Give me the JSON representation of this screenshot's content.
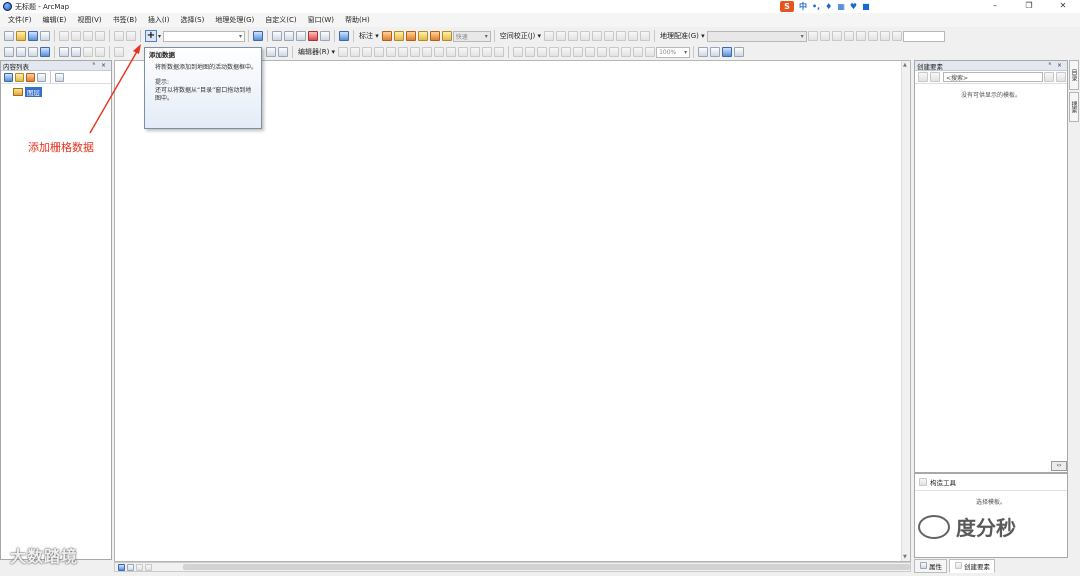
{
  "window": {
    "title": "无标题 - ArcMap",
    "minimize": "–",
    "restore": "❐",
    "close": "✕"
  },
  "ime": {
    "brand": "S",
    "lang": "中"
  },
  "menu": [
    "文件(F)",
    "编辑(E)",
    "视图(V)",
    "书签(B)",
    "插入(I)",
    "选择(S)",
    "地理处理(G)",
    "自定义(C)",
    "窗口(W)",
    "帮助(H)"
  ],
  "toolbar1": {
    "annotation_label": "标注 ▾",
    "snap_combo": "快速",
    "spatial_adjust": "空间校正(J) ▾",
    "georef": "地理配准(G) ▾",
    "add_data": "+"
  },
  "toolbar2": {
    "editor": "编辑器(R) ▾",
    "zoom": "100%"
  },
  "tooltip": {
    "title": "添加数据",
    "desc": "将新数据添加到地图的活动数据框中。",
    "hint_title": "提示:",
    "hint_body": "还可以将数据从“目录”窗口拖动到地图中。"
  },
  "annotation": {
    "text": "添加栅格数据",
    "color": "#e8321e"
  },
  "toc": {
    "title": "内容列表",
    "controls": "ᴿ ×",
    "layer": "图层"
  },
  "create_features": {
    "title": "创建要素",
    "controls": "ᴿ ×",
    "search_placeholder": "<搜索>",
    "empty": "没有可供显示的模板。"
  },
  "construction_tools": {
    "title": "构造工具",
    "message": "选择模板。"
  },
  "bottom_tabs": {
    "attributes": "属性",
    "create": "创建要素"
  },
  "side_tabs": [
    "目录",
    "搜索"
  ],
  "watermarks": {
    "left": "大数踏境",
    "right": "度分秒"
  }
}
